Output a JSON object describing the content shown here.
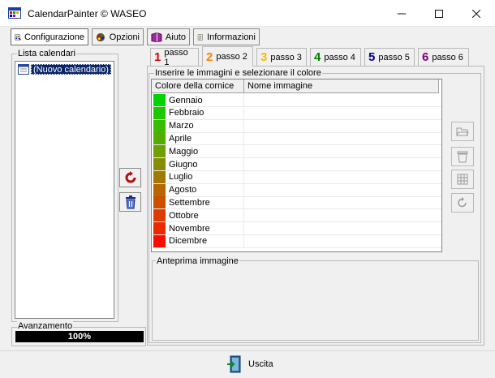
{
  "window": {
    "title": "CalendarPainter © WASEO"
  },
  "menu": [
    {
      "label": "Configurazione",
      "icon": "config-icon"
    },
    {
      "label": "Opzioni",
      "icon": "palette-icon"
    },
    {
      "label": "Aiuto",
      "icon": "book-icon"
    },
    {
      "label": "Informazioni",
      "icon": "info-icon"
    }
  ],
  "left": {
    "list_label": "Lista calendari",
    "item": "(Nuovo calendario)",
    "progress_label": "Avanzamento",
    "progress_text": "100%",
    "progress_value": 1.0
  },
  "tabs": [
    {
      "num": "1",
      "label": "passo 1",
      "color": "#e00000"
    },
    {
      "num": "2",
      "label": "passo 2",
      "color": "#ff8000"
    },
    {
      "num": "3",
      "label": "passo 3",
      "color": "#f0c000"
    },
    {
      "num": "4",
      "label": "passo 4",
      "color": "#008000"
    },
    {
      "num": "5",
      "label": "passo 5",
      "color": "#000090"
    },
    {
      "num": "6",
      "label": "passo 6",
      "color": "#800080"
    }
  ],
  "main": {
    "group_label": "Inserire le immagini e selezionare il colore",
    "col1": "Colore della cornice",
    "col2": "Nome immagine",
    "preview_label": "Anteprima immagine",
    "months": [
      {
        "name": "Gennaio",
        "color": "#00d400"
      },
      {
        "name": "Febbraio",
        "color": "#1ec800"
      },
      {
        "name": "Marzo",
        "color": "#3cbc00"
      },
      {
        "name": "Aprile",
        "color": "#54ac00"
      },
      {
        "name": "Maggio",
        "color": "#6ea000"
      },
      {
        "name": "Giugno",
        "color": "#888c00"
      },
      {
        "name": "Luglio",
        "color": "#a07a00"
      },
      {
        "name": "Agosto",
        "color": "#b86600"
      },
      {
        "name": "Settembre",
        "color": "#cc5000"
      },
      {
        "name": "Ottobre",
        "color": "#dc3c00"
      },
      {
        "name": "Novembre",
        "color": "#ec2800"
      },
      {
        "name": "Dicembre",
        "color": "#ff0a00"
      }
    ]
  },
  "bottom": {
    "exit_label": "Uscita"
  }
}
